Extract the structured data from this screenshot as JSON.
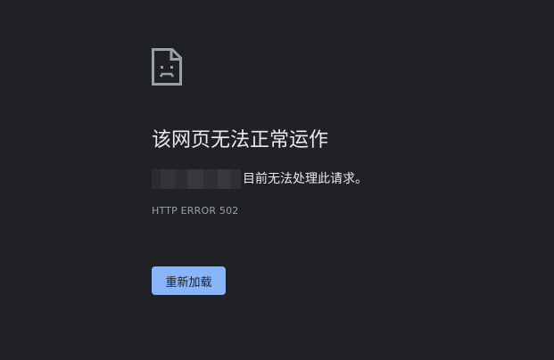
{
  "error_page": {
    "icon": "sad-page-icon",
    "title": "该网页无法正常运作",
    "description": "目前无法处理此请求。",
    "error_code": "HTTP ERROR 502",
    "reload_label": "重新加载"
  },
  "colors": {
    "background": "#202124",
    "text": "#e8eaed",
    "secondary_text": "#9aa0a6",
    "button": "#8ab4f8",
    "button_text": "#202124"
  }
}
